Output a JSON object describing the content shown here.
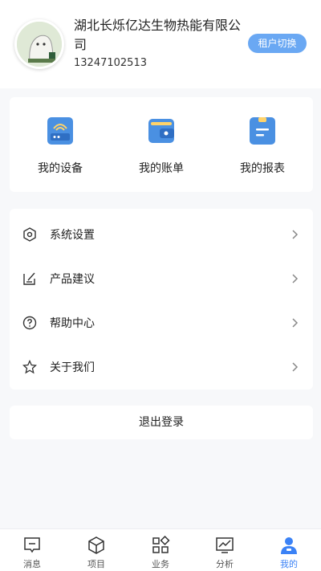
{
  "profile": {
    "company_line1": "湖北长烁亿达生物热能有限公",
    "company_line2": "司",
    "phone": "13247102513",
    "switch_label": "租户切换"
  },
  "quick_actions": [
    {
      "label": "我的设备",
      "icon": "device-icon"
    },
    {
      "label": "我的账单",
      "icon": "wallet-icon"
    },
    {
      "label": "我的报表",
      "icon": "report-icon"
    }
  ],
  "menu": [
    {
      "label": "系统设置",
      "icon": "settings-icon"
    },
    {
      "label": "产品建议",
      "icon": "edit-icon"
    },
    {
      "label": "帮助中心",
      "icon": "help-icon"
    },
    {
      "label": "关于我们",
      "icon": "star-icon"
    }
  ],
  "logout_label": "退出登录",
  "tabs": [
    {
      "label": "消息",
      "icon": "message-icon"
    },
    {
      "label": "项目",
      "icon": "box-icon"
    },
    {
      "label": "业务",
      "icon": "apps-icon"
    },
    {
      "label": "分析",
      "icon": "chart-icon"
    },
    {
      "label": "我的",
      "icon": "user-icon"
    }
  ],
  "colors": {
    "accent": "#3b82f6",
    "switch_bg": "#6aa8f3",
    "background": "#f7f8fa"
  }
}
